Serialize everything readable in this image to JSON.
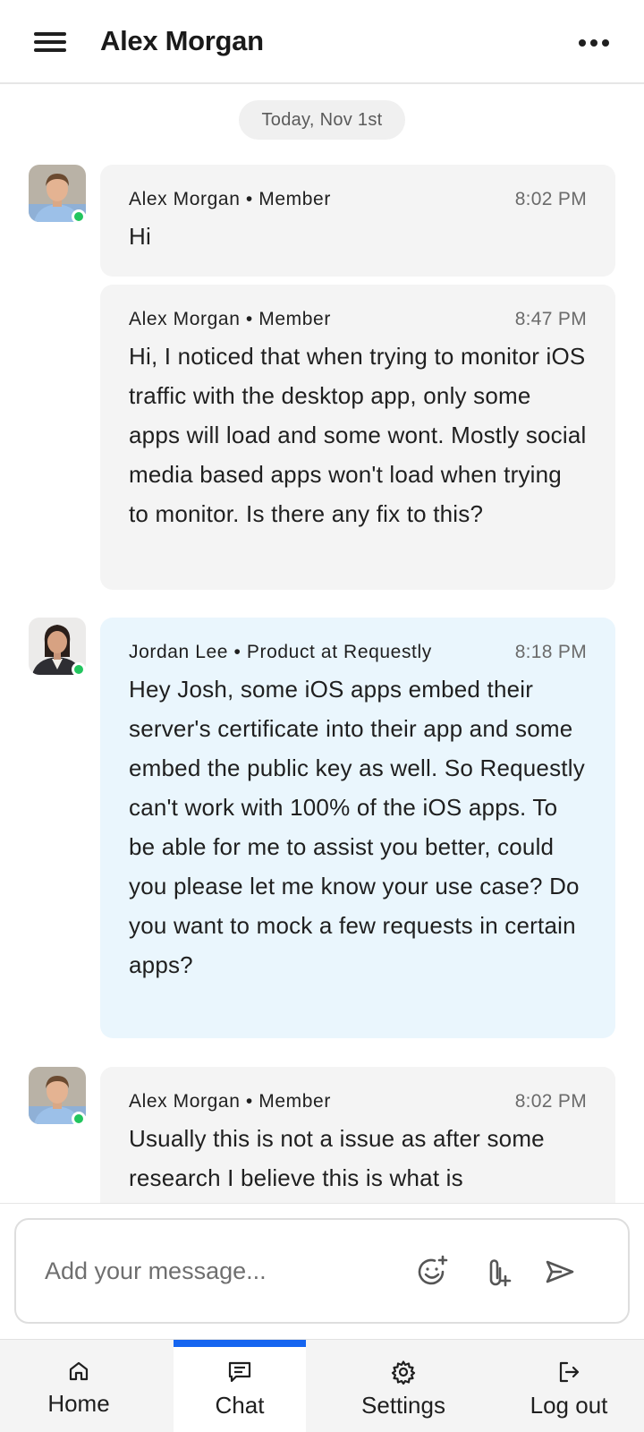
{
  "header": {
    "title": "Alex Morgan"
  },
  "feed": {
    "date_label": "Today, Nov 1st"
  },
  "messages": [
    {
      "sender": "Alex Morgan • Member",
      "time": "8:02 PM",
      "text": "Hi"
    },
    {
      "sender": "Alex Morgan • Member",
      "time": "8:47 PM",
      "text": "Hi, I noticed that when trying to monitor iOS traffic with the desktop app, only some apps will load and some wont. Mostly social media based apps won't load when trying to monitor. Is there any fix to this?"
    },
    {
      "sender": "Jordan Lee • Product at Requestly",
      "time": "8:18 PM",
      "text": "Hey Josh, some iOS apps embed their server's certificate into their app and some embed the public key as well. So Requestly can't work with 100% of the iOS apps. To be able for me to assist you better, could you please let me know your use case? Do you want to mock a few requests in certain apps?"
    },
    {
      "sender": "Alex Morgan • Member",
      "time": "8:02 PM",
      "text": "Usually this is not a issue as after some research I believe this is what is"
    }
  ],
  "composer": {
    "placeholder": "Add your message..."
  },
  "tabs": [
    {
      "label": "Home",
      "icon": "home-icon"
    },
    {
      "label": "Chat",
      "icon": "chat-icon"
    },
    {
      "label": "Settings",
      "icon": "gear-icon"
    },
    {
      "label": "Log out",
      "icon": "logout-icon"
    }
  ],
  "active_tab": "Chat",
  "colors": {
    "accent": "#1565f0",
    "online": "#22c55e",
    "agent_bubble": "#eaf6fd",
    "member_bubble": "#f4f4f4"
  }
}
